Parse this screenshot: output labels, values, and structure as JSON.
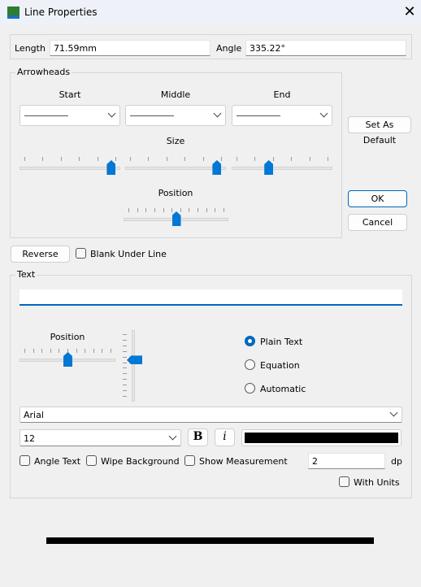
{
  "window": {
    "title": "Line Properties",
    "icon": "app-icon",
    "close_icon": "close-icon"
  },
  "length": {
    "label": "Length",
    "value": "71.59mm"
  },
  "angle": {
    "label": "Angle",
    "value": "335.22°"
  },
  "arrowheads": {
    "legend": "Arrowheads",
    "start_label": "Start",
    "middle_label": "Middle",
    "end_label": "End",
    "size_label": "Size",
    "position_label": "Position",
    "size_values": {
      "start": 0.95,
      "middle": 0.95,
      "end": 0.35
    },
    "position_value": 0.5
  },
  "buttons": {
    "set_default": "Set As Default",
    "ok": "OK",
    "cancel": "Cancel",
    "reverse": "Reverse"
  },
  "blank_under_line": {
    "label": "Blank Under Line",
    "checked": false
  },
  "text": {
    "legend": "Text",
    "value": "",
    "position_label": "Position",
    "position_h": 0.5,
    "position_v": 0.4,
    "modes": [
      {
        "label": "Plain Text",
        "selected": true
      },
      {
        "label": "Equation",
        "selected": false
      },
      {
        "label": "Automatic",
        "selected": false
      }
    ],
    "font": "Arial",
    "size": "12",
    "bold_label": "B",
    "italic_label": "i",
    "color": "#000000",
    "angle_text": "Angle Text",
    "wipe_background": "Wipe Background",
    "show_measurement": "Show Measurement",
    "dp_value": "2",
    "dp_label": "dp",
    "with_units": "With Units"
  },
  "colors": {
    "accent": "#0078d4",
    "line_preview": "#000000"
  }
}
